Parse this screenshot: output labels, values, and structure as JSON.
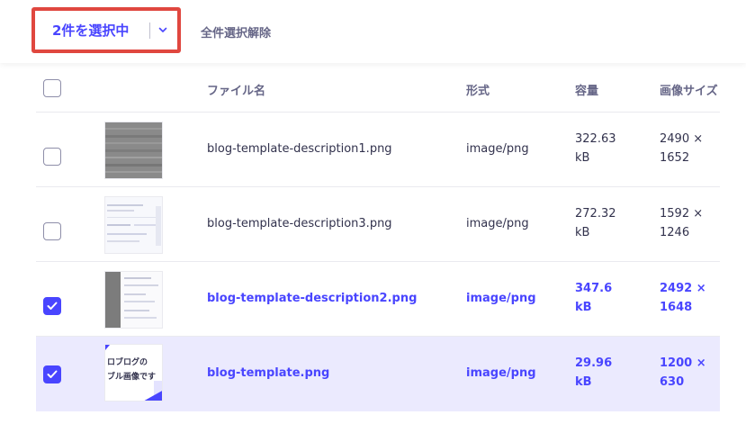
{
  "toolbar": {
    "selected_label": "2件を選択中",
    "clear_all_label": "全件選択解除"
  },
  "table": {
    "headers": {
      "file_name": "ファイル名",
      "format": "形式",
      "size": "容量",
      "dimensions": "画像サイズ"
    },
    "rows": [
      {
        "name": "blog-template-description1.png",
        "format": "image/png",
        "size_value": "322.63",
        "size_unit": "kB",
        "dim_w": "2490 ×",
        "dim_h": "1652",
        "checked": false,
        "thumb": "gray-noise"
      },
      {
        "name": "blog-template-description3.png",
        "format": "image/png",
        "size_value": "272.32",
        "size_unit": "kB",
        "dim_w": "1592 ×",
        "dim_h": "1246",
        "checked": false,
        "thumb": "light-doc"
      },
      {
        "name": "blog-template-description2.png",
        "format": "image/png",
        "size_value": "347.6",
        "size_unit": "kB",
        "dim_w": "2492 ×",
        "dim_h": "1648",
        "checked": true,
        "thumb": "sidebar-doc"
      },
      {
        "name": "blog-template.png",
        "format": "image/png",
        "size_value": "29.96",
        "size_unit": "kB",
        "dim_w": "1200 ×",
        "dim_h": "630",
        "checked": true,
        "thumb": "blog-banner",
        "thumb_text_1": "ロブログの",
        "thumb_text_2": "ブル画像です"
      }
    ]
  },
  "colors": {
    "accent": "#4945ff",
    "highlight": "#e0473f",
    "selected_row_bg": "#ebeafe",
    "muted_text": "#666687"
  },
  "icons": {
    "dropdown": "chevron-down-icon",
    "check": "check-icon"
  }
}
